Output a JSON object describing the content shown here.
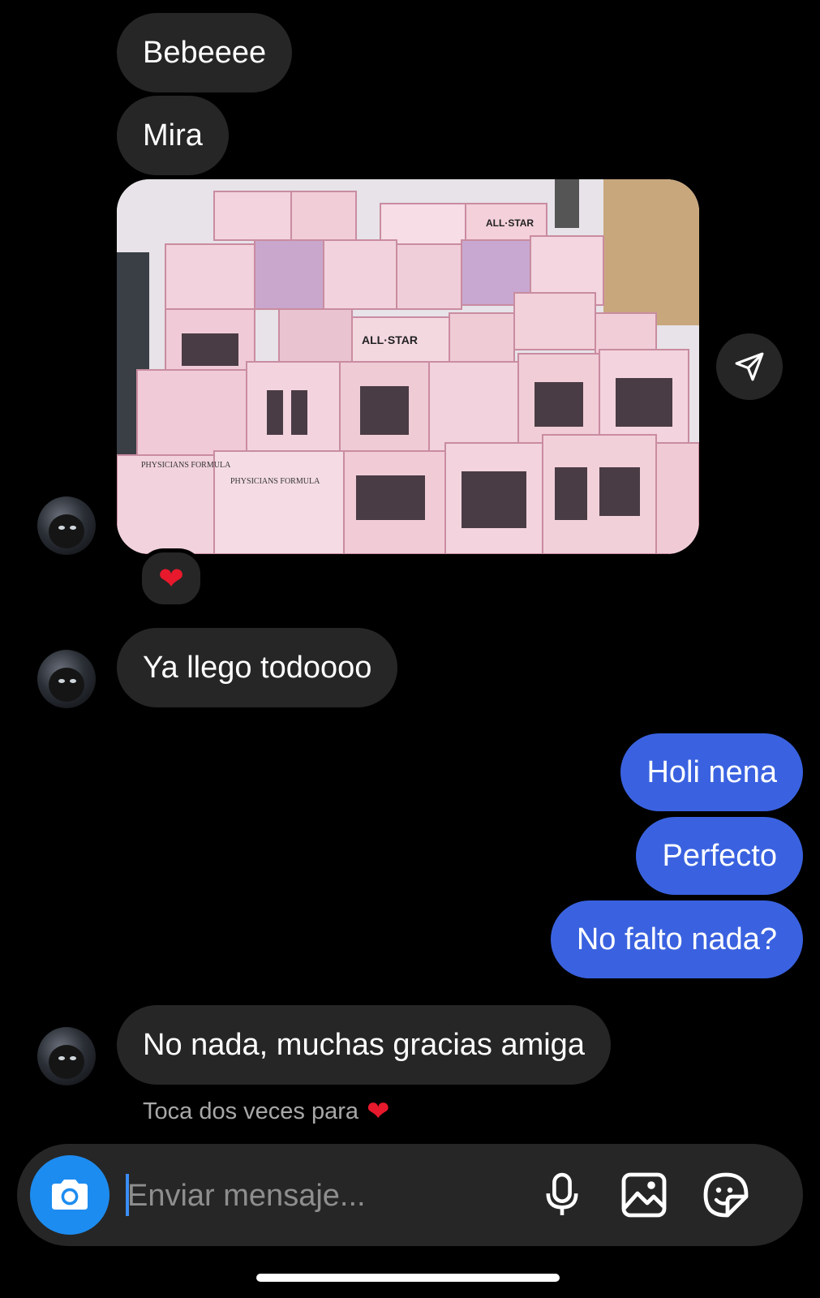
{
  "messages_in": [
    {
      "text": "Bebeeee"
    },
    {
      "text": "Mira"
    },
    {
      "text": "Ya llego todoooo"
    },
    {
      "text": "No nada, muchas gracias amiga"
    }
  ],
  "messages_out": [
    {
      "text": "Holi nena"
    },
    {
      "text": "Perfecto"
    },
    {
      "text": "No falto nada?"
    }
  ],
  "photo": {
    "box_labels": [
      "ALL·STAR",
      "ALL·STAR",
      "PHYSICIANS FORMULA",
      "PHYSICIANS FORMULA"
    ]
  },
  "reaction": {
    "emoji": "❤"
  },
  "hint": {
    "text": "Toca dos veces para",
    "emoji": "❤"
  },
  "composer": {
    "placeholder": "Enviar mensaje..."
  },
  "colors": {
    "incoming_bubble": "#262626",
    "outgoing_bubble": "#3a62e0",
    "camera_button": "#1d8cf0",
    "heart": "#e8192c"
  },
  "icons": [
    "camera-icon",
    "microphone-icon",
    "gallery-icon",
    "sticker-icon",
    "send-icon"
  ]
}
